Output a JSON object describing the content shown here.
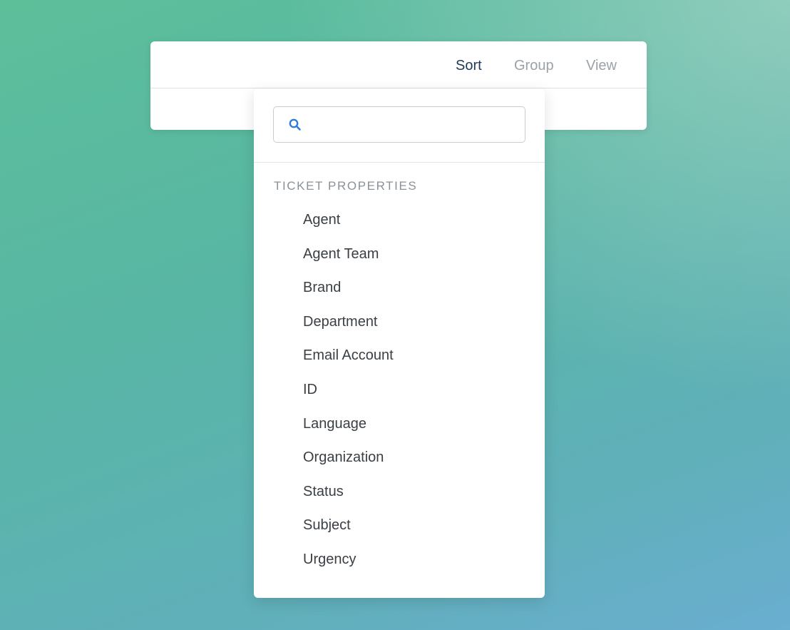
{
  "toolbar": {
    "tabs": [
      {
        "label": "Sort",
        "active": true
      },
      {
        "label": "Group",
        "active": false
      },
      {
        "label": "View",
        "active": false
      }
    ]
  },
  "dropdown": {
    "search": {
      "value": "",
      "placeholder": "",
      "icon": "search-icon"
    },
    "section_title": "TICKET PROPERTIES",
    "items": [
      "Agent",
      "Agent Team",
      "Brand",
      "Department",
      "Email Account",
      "ID",
      "Language",
      "Organization",
      "Status",
      "Subject",
      "Urgency"
    ]
  },
  "colors": {
    "active_tab": "#1f3a56",
    "inactive_tab": "#9aa1a8",
    "search_icon": "#2d7be0",
    "section_header": "#8a9198",
    "item_text": "#3a3f44"
  }
}
